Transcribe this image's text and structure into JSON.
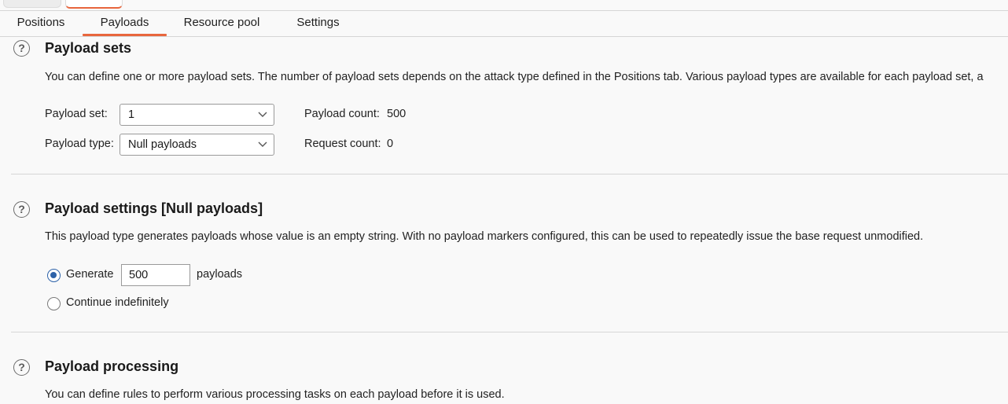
{
  "tabs": {
    "positions": "Positions",
    "payloads": "Payloads",
    "resource_pool": "Resource pool",
    "settings": "Settings",
    "active": "Payloads"
  },
  "payload_sets": {
    "title": "Payload sets",
    "description": "You can define one or more payload sets. The number of payload sets depends on the attack type defined in the Positions tab. Various payload types are available for each payload set, a",
    "set_label": "Payload set:",
    "set_value": "1",
    "type_label": "Payload type:",
    "type_value": "Null payloads",
    "count_label": "Payload count:",
    "count_value": "500",
    "request_label": "Request count:",
    "request_value": "0"
  },
  "payload_settings": {
    "title": "Payload settings [Null payloads]",
    "description": "This payload type generates payloads whose value is an empty string. With no payload markers configured, this can be used to repeatedly issue the base request unmodified.",
    "generate_label": "Generate",
    "generate_value": "500",
    "payloads_suffix": "payloads",
    "continue_label": "Continue indefinitely",
    "selected_option": "generate"
  },
  "payload_processing": {
    "title": "Payload processing",
    "description": "You can define rules to perform various processing tasks on each payload before it is used."
  },
  "icons": {
    "help": "question-circle-icon",
    "dropdown": "chevron-down-icon"
  },
  "colors": {
    "accent": "#e8663d",
    "radio": "#2d62a8"
  }
}
